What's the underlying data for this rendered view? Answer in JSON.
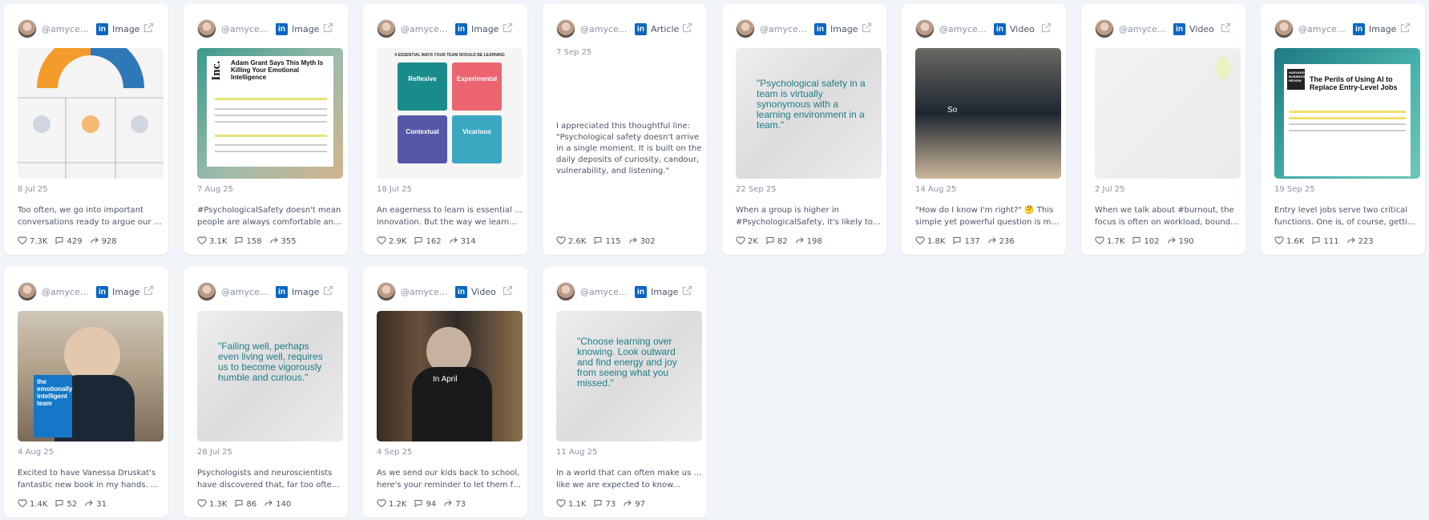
{
  "cards": [
    {
      "handle": "@amycedmondson",
      "type": "Image",
      "date": "8 Jul 25",
      "caption": [
        "Too often, we go into important",
        "conversations ready to argue our poi..."
      ],
      "likes": "7.3K",
      "comments": "429",
      "shares": "928"
    },
    {
      "handle": "@amycedmondson",
      "type": "Image",
      "date": "7 Aug 25",
      "caption": [
        "#PsychologicalSafety doesn't mean",
        "people are always comfortable and..."
      ],
      "likes": "3.1K",
      "comments": "158",
      "shares": "355"
    },
    {
      "handle": "@amycedmondson",
      "type": "Image",
      "date": "18 Jul 25",
      "caption": [
        "An eagerness to learn is essential for",
        "innovation. But the way we learn—an..."
      ],
      "likes": "2.9K",
      "comments": "162",
      "shares": "314"
    },
    {
      "handle": "@amycedmondson",
      "type": "Article",
      "date": "7 Sep 25",
      "caption": [
        "",
        ""
      ],
      "article_body": "I appreciated this thoughtful line: \"Psychological safety doesn't arrive in a single moment. It is built on the daily deposits of curiosity, candour, vulnerability, and listening.\"",
      "likes": "2.6K",
      "comments": "115",
      "shares": "302"
    },
    {
      "handle": "@amycedmondson",
      "type": "Image",
      "date": "22 Sep 25",
      "caption": [
        "When a group is higher in",
        "#PsychologicalSafety, it's likely to be..."
      ],
      "likes": "2K",
      "comments": "82",
      "shares": "198"
    },
    {
      "handle": "@amycedmondson",
      "type": "Video",
      "date": "14 Aug 25",
      "caption": [
        "\"How do I know I'm right?\" 🤔 This",
        "simple yet powerful question is my..."
      ],
      "likes": "1.8K",
      "comments": "137",
      "shares": "236"
    },
    {
      "handle": "@amycedmondson",
      "type": "Video",
      "date": "2 Jul 25",
      "caption": [
        "When we talk about #burnout, the",
        "focus is often on workload, boundarie..."
      ],
      "likes": "1.7K",
      "comments": "102",
      "shares": "190"
    },
    {
      "handle": "@amycedmondson",
      "type": "Image",
      "date": "19 Sep 25",
      "caption": [
        "Entry level jobs serve two critical",
        "functions. One is, of course, getting..."
      ],
      "likes": "1.6K",
      "comments": "111",
      "shares": "223"
    },
    {
      "handle": "@amycedmondson",
      "type": "Image",
      "date": "4 Aug 25",
      "caption": [
        "Excited to have Vanessa Druskat's",
        "fantastic new book in my hands. A..."
      ],
      "likes": "1.4K",
      "comments": "52",
      "shares": "31"
    },
    {
      "handle": "@amycedmondson",
      "type": "Image",
      "date": "28 Jul 25",
      "caption": [
        "Psychologists and neuroscientists",
        "have discovered that, far too often for..."
      ],
      "likes": "1.3K",
      "comments": "86",
      "shares": "140"
    },
    {
      "handle": "@amycedmondson",
      "type": "Video",
      "date": "4 Sep 25",
      "caption": [
        "As we send our kids back to school,",
        "here's your reminder to let them fail...."
      ],
      "likes": "1.2K",
      "comments": "94",
      "shares": "73"
    },
    {
      "handle": "@amycedmondson",
      "type": "Image",
      "date": "11 Aug 25",
      "caption": [
        "In a world that can often make us feel",
        "like we are expected to know..."
      ],
      "likes": "1.1K",
      "comments": "73",
      "shares": "97"
    }
  ],
  "media": {
    "inc_headline": "Adam Grant Says This Myth Is Killing Your Emotional Intelligence",
    "inc_logo": "Inc.",
    "quad_title": "4 ESSENTIAL WAYS YOUR TEAM SHOULD BE LEARNING",
    "quad_cells": [
      "Reflexive",
      "Experimental",
      "Contextual",
      "Vicarious"
    ],
    "quote1": "\"Psychological safety in a team is virtually synonymous with a learning environment in a team.\"",
    "video1_word": "So",
    "hbr_title": "The Perils of Using AI to Replace Entry-Level Jobs",
    "hbr_logo": "HARVARD BUSINESS REVIEW",
    "book_title": "the emotionally intelligent team",
    "quote2": "\"Failing well, perhaps even living well, requires us to become vigorously humble and curious.\"",
    "video2_word": "In April",
    "quote3": "\"Choose learning over knowing. Look outward and find energy and joy from seeing what you missed.\""
  },
  "colors": {
    "linkedin": "#0a66c2",
    "teal": "#1e7c89",
    "background": "#f1f4f8"
  }
}
